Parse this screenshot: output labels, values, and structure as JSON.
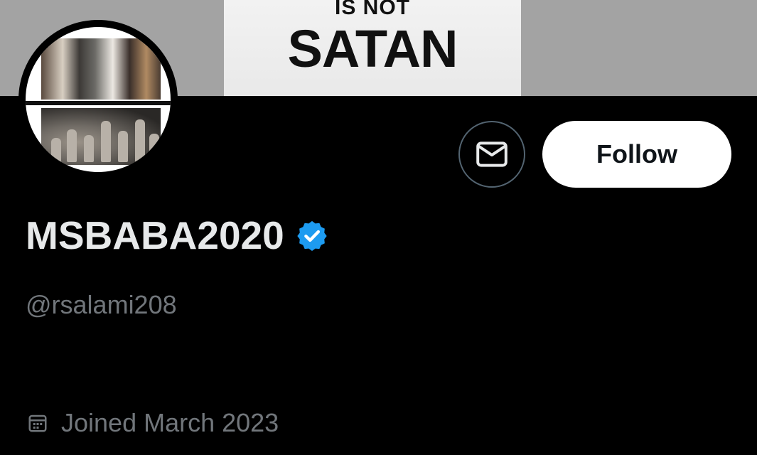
{
  "banner": {
    "line1": "IS NOT",
    "line2": "SATAN"
  },
  "actions": {
    "message_icon": "envelope-icon",
    "follow_label": "Follow"
  },
  "profile": {
    "display_name": "MSBABA2020",
    "verified_icon": "verified-badge-icon",
    "handle": "@rsalami208",
    "joined_icon": "calendar-icon",
    "joined": "Joined March 2023"
  },
  "colors": {
    "background": "#000000",
    "primary_text": "#e7e9ea",
    "secondary_text": "#71767b",
    "verified_blue": "#1d9bf0",
    "follow_bg": "#ffffff"
  }
}
